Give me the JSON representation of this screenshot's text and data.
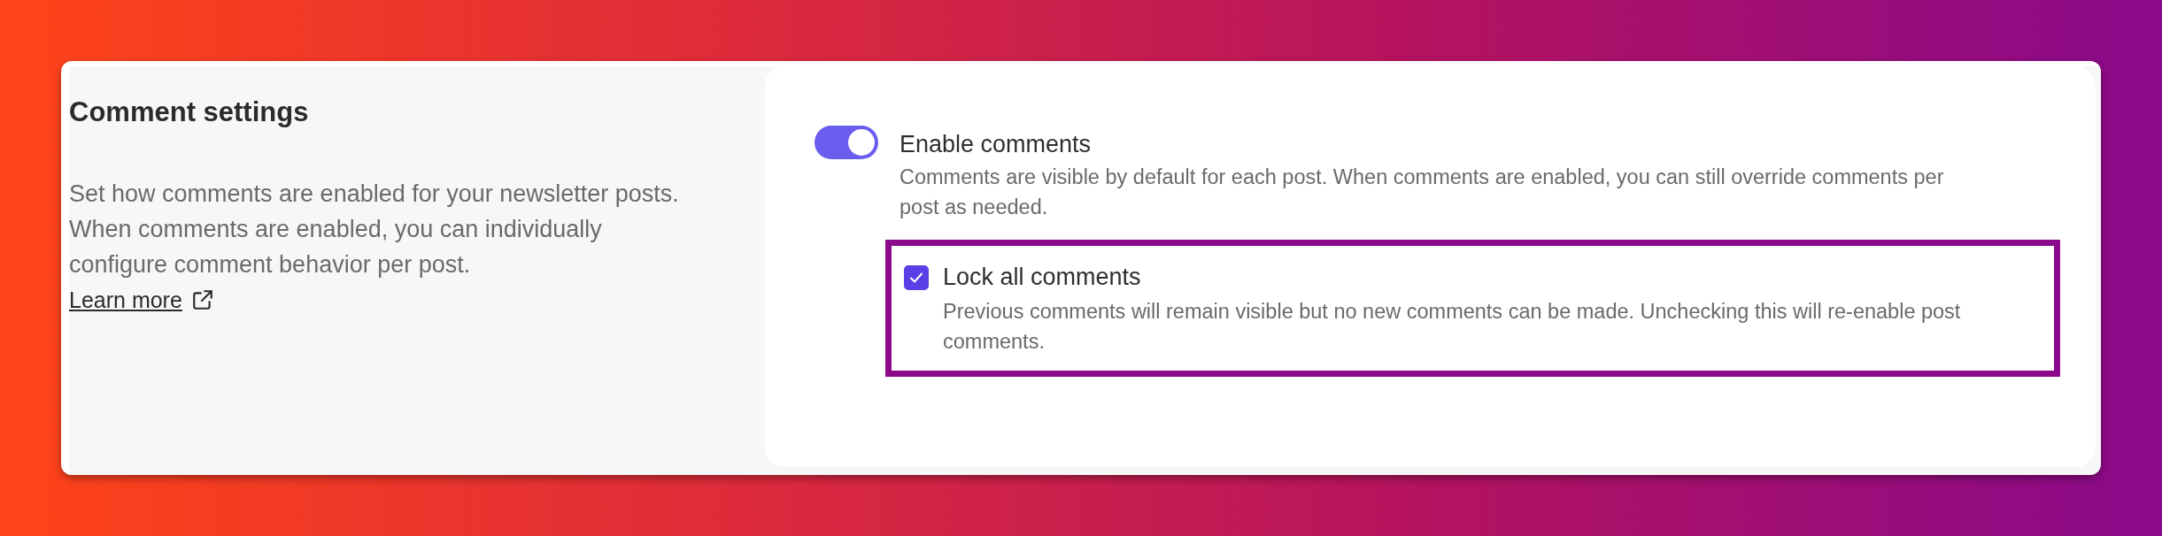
{
  "section": {
    "title": "Comment settings",
    "description": "Set how comments are enabled for your newsletter posts. When comments are enabled, you can individually configure comment behavior per post.",
    "link": "Learn more"
  },
  "toggle": {
    "label": "Enable comments",
    "on": true,
    "description": "Comments are visible by default for each post. When comments are enabled, you can still override comments per post as needed."
  },
  "checkbox": {
    "label": "Lock all comments",
    "checked": true,
    "highlighted": true,
    "description": "Previous comments will remain visible but no new comments can be made. Unchecking this will re-enable post comments."
  }
}
